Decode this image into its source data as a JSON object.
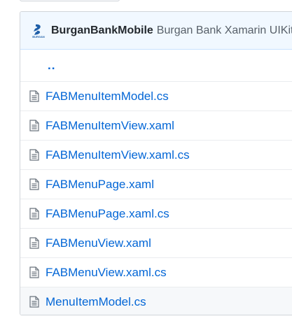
{
  "header": {
    "repo_name": "BurganBankMobile",
    "repo_description": "Burgan Bank Xamarin UIKit"
  },
  "parent_dir": "..",
  "files": [
    {
      "name": "FABMenuItemModel.cs"
    },
    {
      "name": "FABMenuItemView.xaml"
    },
    {
      "name": "FABMenuItemView.xaml.cs"
    },
    {
      "name": "FABMenuPage.xaml"
    },
    {
      "name": "FABMenuPage.xaml.cs"
    },
    {
      "name": "FABMenuView.xaml"
    },
    {
      "name": "FABMenuView.xaml.cs"
    },
    {
      "name": "MenuItemModel.cs"
    }
  ],
  "colors": {
    "link": "#0366d6",
    "header_bg": "#f1f8ff",
    "logo_blue": "#1f5fa8"
  },
  "icons": {
    "logo": "burgan-bank-logo",
    "file": "file-text-icon"
  }
}
